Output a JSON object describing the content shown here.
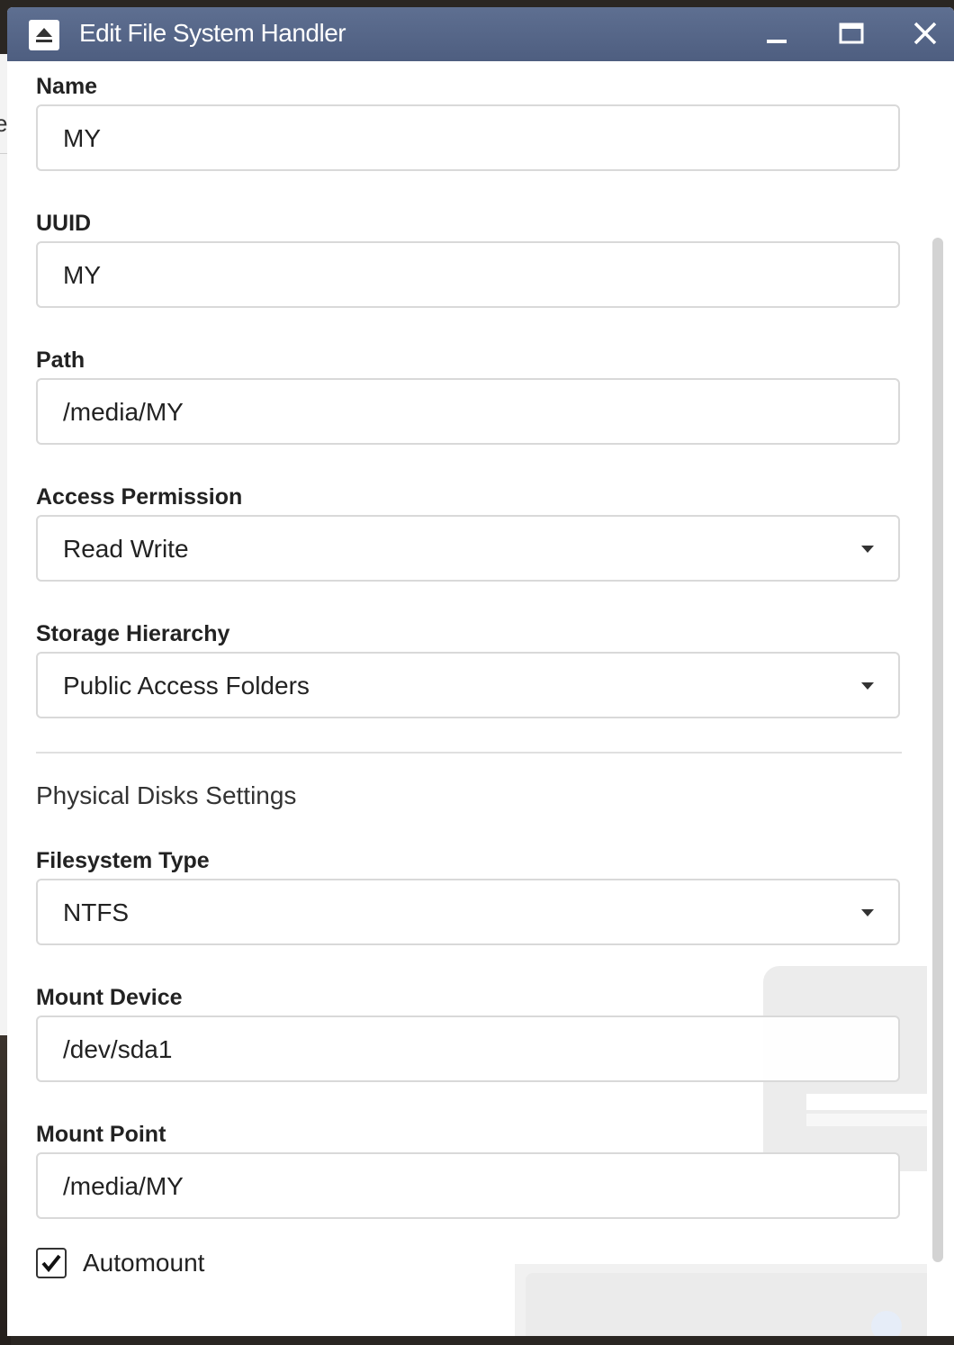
{
  "window": {
    "title": "Edit File System Handler"
  },
  "background": {
    "fragment_text": "e"
  },
  "form": {
    "name": {
      "label": "Name",
      "value": "MY"
    },
    "uuid": {
      "label": "UUID",
      "value": "MY"
    },
    "path": {
      "label": "Path",
      "value": "/media/MY"
    },
    "access_permission": {
      "label": "Access Permission",
      "selected": "Read Write"
    },
    "storage_hierarchy": {
      "label": "Storage Hierarchy",
      "selected": "Public Access Folders"
    },
    "physical_section": "Physical Disks Settings",
    "filesystem_type": {
      "label": "Filesystem Type",
      "selected": "NTFS"
    },
    "mount_device": {
      "label": "Mount Device",
      "value": "/dev/sda1"
    },
    "mount_point": {
      "label": "Mount Point",
      "value": "/media/MY"
    },
    "automount": {
      "label": "Automount",
      "checked": true
    }
  },
  "icons": {
    "app": "eject-icon",
    "minimize": "minimize-icon",
    "maximize": "maximize-icon",
    "close": "close-icon",
    "dropdown": "caret-down-icon",
    "check": "check-icon"
  },
  "colors": {
    "titlebar": "#56678a",
    "border": "#d9d9d9",
    "text": "#222222"
  }
}
